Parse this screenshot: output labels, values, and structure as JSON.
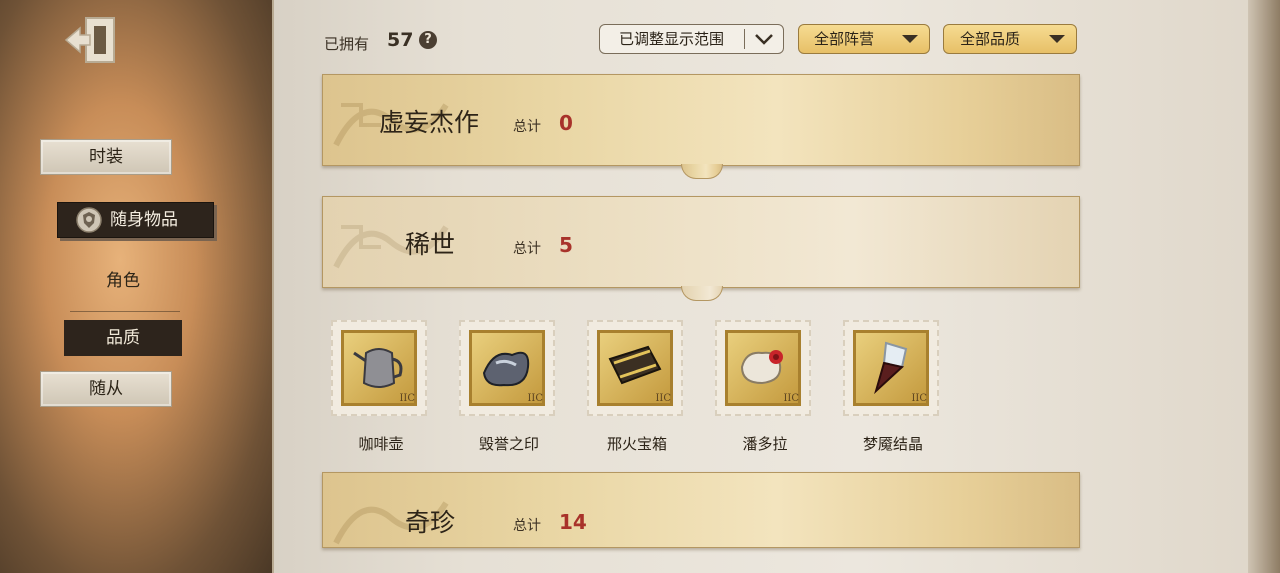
{
  "sidebar": {
    "exit_icon": "exit-door-icon",
    "items": [
      {
        "label": "时装"
      },
      {
        "label": "随身物品",
        "icon": "shield-badge-icon"
      },
      {
        "label": "角色"
      },
      {
        "label": "品质"
      },
      {
        "label": "随从"
      }
    ]
  },
  "header": {
    "owned_label": "已拥有",
    "owned_count": "57",
    "help_icon": "?",
    "range_filter": "已调整显示范围",
    "camp_filter": "全部阵营",
    "quality_filter": "全部品质"
  },
  "sections": [
    {
      "title": "虚妄杰作",
      "total_label": "总计",
      "total": "0"
    },
    {
      "title": "稀世",
      "total_label": "总计",
      "total": "5"
    },
    {
      "title": "奇珍",
      "total_label": "总计",
      "total": "14"
    }
  ],
  "items": [
    {
      "name": "咖啡壶",
      "icon": "coffee-pot-icon",
      "level": "IIC"
    },
    {
      "name": "毁誉之印",
      "icon": "seal-icon",
      "level": "IIC"
    },
    {
      "name": "邢火宝箱",
      "icon": "treasure-chest-icon",
      "level": "IIC"
    },
    {
      "name": "潘多拉",
      "icon": "pandora-box-icon",
      "level": "IIC"
    },
    {
      "name": "梦魇结晶",
      "icon": "crystal-icon",
      "level": "IIC"
    }
  ],
  "colors": {
    "accent_red": "#a8322a",
    "gold": "#e7c067",
    "dark_nav": "#2d241c"
  }
}
